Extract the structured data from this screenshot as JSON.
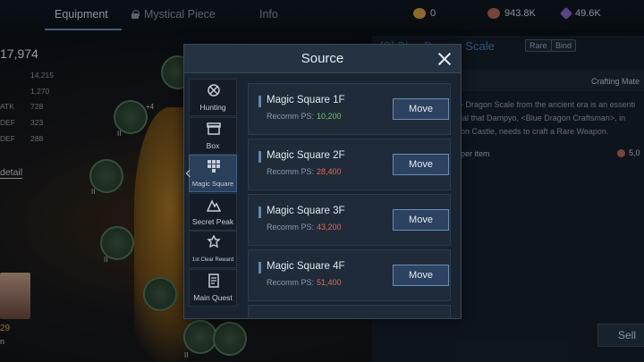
{
  "tabs": [
    {
      "label": "Equipment",
      "active": true
    },
    {
      "label": "Mystical Piece",
      "locked": true
    },
    {
      "label": "Info"
    }
  ],
  "currencies": [
    {
      "icon": "gold-ingot-icon",
      "value": "0",
      "color": "#d9a440"
    },
    {
      "icon": "copper-coin-icon",
      "value": "943.8K",
      "color": "#b86a5a"
    },
    {
      "icon": "purple-crystal-icon",
      "value": "49.6K",
      "color": "#8a6ad0"
    }
  ],
  "stats": {
    "power": "17,974",
    "rows": [
      {
        "label": "",
        "value": "14,215"
      },
      {
        "label": "",
        "value": "1,270"
      },
      {
        "label": "ATK",
        "value": "728"
      },
      {
        "label": "DEF",
        "value": "323"
      },
      {
        "label": "DEF",
        "value": "288"
      }
    ],
    "detail_link": "detail"
  },
  "character": {
    "level": "29",
    "name_fragment": "n"
  },
  "slots": {
    "enhance_label": "+4",
    "marks": [
      "II",
      "II",
      "II",
      "II"
    ]
  },
  "item_panel": {
    "title": "[S] Blue Dragon Scale",
    "badges": [
      "Rare",
      "Bind"
    ],
    "crafting_label": "Crafting Mate",
    "description": "- Dragon Scale from the ancient era is an essenti... ial that Dampyo, <Blue Dragon Craftsman>, in ... on Castle, needs to craft a Rare Weapon.",
    "description_lines": [
      "- Dragon Scale from the ancient era is an essenti",
      "ial that Dampyo, <Blue Dragon Craftsman>, in",
      "on Castle, needs to craft a Rare Weapon."
    ],
    "upper_item_label": "per item",
    "upper_item_value": "5,0",
    "sell_label": "Sell"
  },
  "modal": {
    "title": "Source",
    "categories": [
      {
        "label": "Hunting",
        "icon": "hunting-icon",
        "active": false
      },
      {
        "label": "Box",
        "icon": "box-icon",
        "active": false
      },
      {
        "label": "Magic Square",
        "icon": "magic-square-icon",
        "active": true
      },
      {
        "label": "Secret Peak",
        "icon": "secret-peak-icon",
        "active": false
      },
      {
        "label": "1st Clear Reward",
        "icon": "clear-reward-icon",
        "active": false
      },
      {
        "label": "Main Quest",
        "icon": "main-quest-icon",
        "active": false
      }
    ],
    "sources": [
      {
        "name": "Magic Square 1F",
        "ps_label": "Recomm PS:",
        "ps": "10,200",
        "ps_color": "#6ec76a",
        "button": "Move"
      },
      {
        "name": "Magic Square 2F",
        "ps_label": "Recomm PS:",
        "ps": "28,400",
        "ps_color": "#e0685a",
        "button": "Move"
      },
      {
        "name": "Magic Square 3F",
        "ps_label": "Recomm PS:",
        "ps": "43,200",
        "ps_color": "#e0685a",
        "button": "Move"
      },
      {
        "name": "Magic Square 4F",
        "ps_label": "Recomm PS:",
        "ps": "51,400",
        "ps_color": "#e0685a",
        "button": "Move"
      }
    ]
  }
}
